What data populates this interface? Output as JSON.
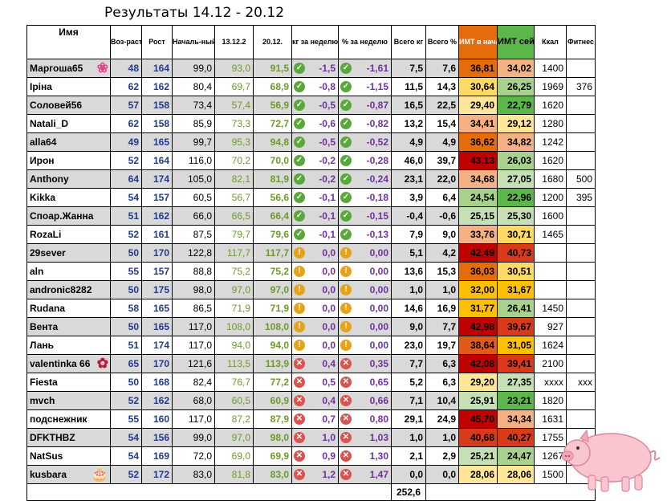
{
  "title": "Результаты 14.12 - 20.12",
  "headers": [
    "Имя",
    "Воз-раст",
    "Рост",
    "Началь-ный вес",
    "13.12.2",
    "20.12.",
    "кг за неделю",
    "% за неделю",
    "Всего кг",
    "Всего %",
    "ИМТ в начале",
    "ИМТ сейчас",
    "Ккал",
    "Фитнес"
  ],
  "rows": [
    {
      "name": "Маргоша65",
      "age": "48",
      "height": "164",
      "start": "99,0",
      "prev": "93,0",
      "cur": "91,5",
      "kg_icon": "down-icon",
      "kg": "-1,5",
      "pct_icon": "down-icon",
      "pct": "-1,61",
      "total_kg": "7,5",
      "total_pct": "7,6",
      "bmi_start": "36,81",
      "bmi_start_color": "#e46c0a",
      "bmi_now": "34,02",
      "bmi_now_color": "#f4b183",
      "kcal": "1400",
      "fit": "",
      "decor": "flower-icon"
    },
    {
      "name": "Іріна",
      "age": "62",
      "height": "162",
      "start": "80,4",
      "prev": "69,7",
      "cur": "68,9",
      "kg_icon": "down-icon",
      "kg": "-0,8",
      "pct_icon": "down-icon",
      "pct": "-1,15",
      "total_kg": "11,5",
      "total_pct": "14,3",
      "bmi_start": "30,64",
      "bmi_start_color": "#ffd966",
      "bmi_now": "26,25",
      "bmi_now_color": "#a9d18e",
      "kcal": "1969",
      "fit": "376",
      "decor": ""
    },
    {
      "name": "Соловей56",
      "age": "57",
      "height": "158",
      "start": "73,4",
      "prev": "57,4",
      "cur": "56,9",
      "kg_icon": "down-icon",
      "kg": "-0,5",
      "pct_icon": "down-icon",
      "pct": "-0,87",
      "total_kg": "16,5",
      "total_pct": "22,5",
      "bmi_start": "29,40",
      "bmi_start_color": "#ffe699",
      "bmi_now": "22,79",
      "bmi_now_color": "#5bb74a",
      "kcal": "1620",
      "fit": "",
      "decor": ""
    },
    {
      "name": "Natali_D",
      "age": "62",
      "height": "158",
      "start": "85,9",
      "prev": "73,3",
      "cur": "72,7",
      "kg_icon": "down-icon",
      "kg": "-0,6",
      "pct_icon": "down-icon",
      "pct": "-0,82",
      "total_kg": "13,2",
      "total_pct": "15,4",
      "bmi_start": "34,41",
      "bmi_start_color": "#f4b183",
      "bmi_now": "29,12",
      "bmi_now_color": "#ffe699",
      "kcal": "1280",
      "fit": "",
      "decor": ""
    },
    {
      "name": "alla64",
      "age": "49",
      "height": "165",
      "start": "99,7",
      "prev": "95,3",
      "cur": "94,8",
      "kg_icon": "down-icon",
      "kg": "-0,5",
      "pct_icon": "down-icon",
      "pct": "-0,52",
      "total_kg": "4,9",
      "total_pct": "4,9",
      "bmi_start": "36,62",
      "bmi_start_color": "#e46c0a",
      "bmi_now": "34,82",
      "bmi_now_color": "#f4b183",
      "kcal": "1242",
      "fit": "",
      "decor": ""
    },
    {
      "name": "Ирон",
      "age": "52",
      "height": "164",
      "start": "116,0",
      "prev": "70,2",
      "cur": "70,0",
      "kg_icon": "down-icon",
      "kg": "-0,2",
      "pct_icon": "down-icon",
      "pct": "-0,28",
      "total_kg": "46,0",
      "total_pct": "39,7",
      "bmi_start": "43,13",
      "bmi_start_color": "#c00000",
      "bmi_now": "26,03",
      "bmi_now_color": "#a9d18e",
      "kcal": "1620",
      "fit": "",
      "decor": ""
    },
    {
      "name": "Anthony",
      "age": "64",
      "height": "174",
      "start": "105,0",
      "prev": "82,1",
      "cur": "81,9",
      "kg_icon": "down-icon",
      "kg": "-0,2",
      "pct_icon": "down-icon",
      "pct": "-0,24",
      "total_kg": "23,1",
      "total_pct": "22,0",
      "bmi_start": "34,68",
      "bmi_start_color": "#f4b183",
      "bmi_now": "27,05",
      "bmi_now_color": "#c5e0b4",
      "kcal": "1680",
      "fit": "500",
      "decor": ""
    },
    {
      "name": "Kikka",
      "age": "54",
      "height": "157",
      "start": "60,5",
      "prev": "56,7",
      "cur": "56,6",
      "kg_icon": "down-icon",
      "kg": "-0,1",
      "pct_icon": "down-icon",
      "pct": "-0,18",
      "total_kg": "3,9",
      "total_pct": "6,4",
      "bmi_start": "24,54",
      "bmi_start_color": "#a9d18e",
      "bmi_now": "22,96",
      "bmi_now_color": "#5bb74a",
      "kcal": "1200",
      "fit": "395",
      "decor": ""
    },
    {
      "name": "Споар.Жанна",
      "age": "51",
      "height": "162",
      "start": "66,0",
      "prev": "66,5",
      "cur": "66,4",
      "kg_icon": "down-icon",
      "kg": "-0,1",
      "pct_icon": "down-icon",
      "pct": "-0,15",
      "total_kg": "-0,4",
      "total_pct": "-0,6",
      "bmi_start": "25,15",
      "bmi_start_color": "#c5e0b4",
      "bmi_now": "25,30",
      "bmi_now_color": "#c5e0b4",
      "kcal": "1600",
      "fit": "",
      "decor": ""
    },
    {
      "name": "RozaLi",
      "age": "52",
      "height": "161",
      "start": "87,5",
      "prev": "79,7",
      "cur": "79,6",
      "kg_icon": "down-icon",
      "kg": "-0,1",
      "pct_icon": "down-icon",
      "pct": "-0,13",
      "total_kg": "7,9",
      "total_pct": "9,0",
      "bmi_start": "33,76",
      "bmi_start_color": "#f4b183",
      "bmi_now": "30,71",
      "bmi_now_color": "#ffd966",
      "kcal": "1465",
      "fit": "",
      "decor": ""
    },
    {
      "name": "29sever",
      "age": "50",
      "height": "170",
      "start": "122,8",
      "prev": "117,7",
      "cur": "117,7",
      "kg_icon": "zero-icon",
      "kg": "0,0",
      "pct_icon": "zero-icon",
      "pct": "0,00",
      "total_kg": "5,1",
      "total_pct": "4,2",
      "bmi_start": "42,49",
      "bmi_start_color": "#c00000",
      "bmi_now": "40,73",
      "bmi_now_color": "#d83a1a",
      "kcal": "",
      "fit": "",
      "decor": ""
    },
    {
      "name": "aln",
      "age": "55",
      "height": "157",
      "start": "88,8",
      "prev": "75,2",
      "cur": "75,2",
      "kg_icon": "zero-icon",
      "kg": "0,0",
      "pct_icon": "zero-icon",
      "pct": "0,00",
      "total_kg": "13,6",
      "total_pct": "15,3",
      "bmi_start": "36,03",
      "bmi_start_color": "#e46c0a",
      "bmi_now": "30,51",
      "bmi_now_color": "#ffd966",
      "kcal": "",
      "fit": "",
      "decor": ""
    },
    {
      "name": "andronic8282",
      "age": "50",
      "height": "175",
      "start": "98,0",
      "prev": "97,0",
      "cur": "97,0",
      "kg_icon": "zero-icon",
      "kg": "0,0",
      "pct_icon": "zero-icon",
      "pct": "0,00",
      "total_kg": "1,0",
      "total_pct": "1,0",
      "bmi_start": "32,00",
      "bmi_start_color": "#ffc000",
      "bmi_now": "31,67",
      "bmi_now_color": "#ffc000",
      "kcal": "",
      "fit": "",
      "decor": ""
    },
    {
      "name": "Rudana",
      "age": "58",
      "height": "165",
      "start": "86,5",
      "prev": "71,9",
      "cur": "71,9",
      "kg_icon": "zero-icon",
      "kg": "0,0",
      "pct_icon": "zero-icon",
      "pct": "0,00",
      "total_kg": "14,6",
      "total_pct": "16,9",
      "bmi_start": "31,77",
      "bmi_start_color": "#ffc000",
      "bmi_now": "26,41",
      "bmi_now_color": "#a9d18e",
      "kcal": "1450",
      "fit": "",
      "decor": ""
    },
    {
      "name": "Вента",
      "age": "50",
      "height": "165",
      "start": "117,0",
      "prev": "108,0",
      "cur": "108,0",
      "kg_icon": "zero-icon",
      "kg": "0,0",
      "pct_icon": "zero-icon",
      "pct": "0,00",
      "total_kg": "9,0",
      "total_pct": "7,7",
      "bmi_start": "42,98",
      "bmi_start_color": "#c00000",
      "bmi_now": "39,67",
      "bmi_now_color": "#d83a1a",
      "kcal": "927",
      "fit": "",
      "decor": ""
    },
    {
      "name": "Лань",
      "age": "51",
      "height": "174",
      "start": "117,0",
      "prev": "94,0",
      "cur": "94,0",
      "kg_icon": "zero-icon",
      "kg": "0,0",
      "pct_icon": "zero-icon",
      "pct": "0,00",
      "total_kg": "23,0",
      "total_pct": "19,7",
      "bmi_start": "38,64",
      "bmi_start_color": "#e05a1a",
      "bmi_now": "31,05",
      "bmi_now_color": "#ffc000",
      "kcal": "1624",
      "fit": "",
      "decor": ""
    },
    {
      "name": "valentinka 66",
      "age": "65",
      "height": "170",
      "start": "121,6",
      "prev": "113,5",
      "cur": "113,9",
      "kg_icon": "up-icon",
      "kg": "0,4",
      "pct_icon": "up-icon",
      "pct": "0,35",
      "total_kg": "7,7",
      "total_pct": "6,3",
      "bmi_start": "42,08",
      "bmi_start_color": "#c00000",
      "bmi_now": "39,41",
      "bmi_now_color": "#d83a1a",
      "kcal": "2100",
      "fit": "",
      "decor": "rose-icon"
    },
    {
      "name": "Fiesta",
      "age": "50",
      "height": "168",
      "start": "82,4",
      "prev": "76,7",
      "cur": "77,2",
      "kg_icon": "up-icon",
      "kg": "0,5",
      "pct_icon": "up-icon",
      "pct": "0,65",
      "total_kg": "5,2",
      "total_pct": "6,3",
      "bmi_start": "29,20",
      "bmi_start_color": "#ffe699",
      "bmi_now": "27,35",
      "bmi_now_color": "#c5e0b4",
      "kcal": "xxxx",
      "fit": "xxx",
      "decor": ""
    },
    {
      "name": "mvch",
      "age": "52",
      "height": "162",
      "start": "68,0",
      "prev": "60,5",
      "cur": "60,9",
      "kg_icon": "up-icon",
      "kg": "0,4",
      "pct_icon": "up-icon",
      "pct": "0,66",
      "total_kg": "7,1",
      "total_pct": "10,4",
      "bmi_start": "25,91",
      "bmi_start_color": "#c5e0b4",
      "bmi_now": "23,21",
      "bmi_now_color": "#5bb74a",
      "kcal": "1820",
      "fit": "",
      "decor": ""
    },
    {
      "name": "подснежник",
      "age": "55",
      "height": "160",
      "start": "117,0",
      "prev": "87,2",
      "cur": "87,9",
      "kg_icon": "up-icon",
      "kg": "0,7",
      "pct_icon": "up-icon",
      "pct": "0,80",
      "total_kg": "29,1",
      "total_pct": "24,9",
      "bmi_start": "45,70",
      "bmi_start_color": "#c00000",
      "bmi_now": "34,34",
      "bmi_now_color": "#f4b183",
      "kcal": "1631",
      "fit": "",
      "decor": ""
    },
    {
      "name": "DFKTHBZ",
      "age": "54",
      "height": "156",
      "start": "99,0",
      "prev": "97,0",
      "cur": "98,0",
      "kg_icon": "up-icon",
      "kg": "1,0",
      "pct_icon": "up-icon",
      "pct": "1,03",
      "total_kg": "1,0",
      "total_pct": "1,0",
      "bmi_start": "40,68",
      "bmi_start_color": "#d83a1a",
      "bmi_now": "40,27",
      "bmi_now_color": "#d83a1a",
      "kcal": "1755",
      "fit": "",
      "decor": ""
    },
    {
      "name": "NatSus",
      "age": "54",
      "height": "169",
      "start": "72,0",
      "prev": "69,0",
      "cur": "69,9",
      "kg_icon": "up-icon",
      "kg": "0,9",
      "pct_icon": "up-icon",
      "pct": "1,30",
      "total_kg": "2,1",
      "total_pct": "2,9",
      "bmi_start": "25,21",
      "bmi_start_color": "#c5e0b4",
      "bmi_now": "24,47",
      "bmi_now_color": "#a9d18e",
      "kcal": "1267",
      "fit": "",
      "decor": ""
    },
    {
      "name": "kusbara",
      "age": "52",
      "height": "172",
      "start": "83,0",
      "prev": "81,8",
      "cur": "83,0",
      "kg_icon": "up-icon",
      "kg": "1,2",
      "pct_icon": "up-icon",
      "pct": "1,47",
      "total_kg": "0,0",
      "total_pct": "0,0",
      "bmi_start": "28,06",
      "bmi_start_color": "#ffe699",
      "bmi_now": "28,06",
      "bmi_now_color": "#ffe699",
      "kcal": "1500",
      "fit": "",
      "decor": "cake-icon"
    }
  ],
  "total_kg_sum": "252,6",
  "icon_colors": {
    "down-icon": "#5aa83a",
    "zero-icon": "#e5a31a",
    "up-icon": "#d9534f"
  },
  "pig_picture": "pig-icon"
}
